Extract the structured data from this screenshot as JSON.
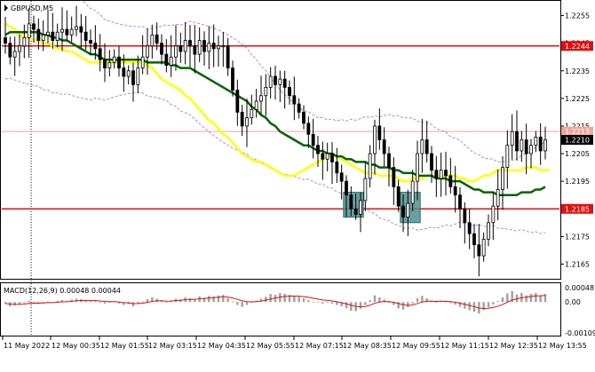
{
  "chart_data": {
    "type": "candlestick",
    "title": "GBPUSD,M5",
    "price_axis": {
      "range": [
        1.216,
        1.226
      ],
      "ticks": [
        "1.2255",
        "1.2245",
        "1.2235",
        "1.2225",
        "1.2215",
        "1.2205",
        "1.2195",
        "1.2185",
        "1.2175",
        "1.2165"
      ]
    },
    "time_axis_labels": [
      "11 May 2022",
      "12 May 00:35",
      "12 May 01:55",
      "12 May 03:15",
      "12 May 04:35",
      "12 May 05:55",
      "12 May 07:15",
      "12 May 08:35",
      "12 May 09:55",
      "12 May 11:15",
      "12 May 12:35",
      "12 May 13:55"
    ],
    "horizontal_levels": [
      {
        "value": 1.2244,
        "label": "1.2244",
        "color": "#e01010"
      },
      {
        "value": 1.2213,
        "label": "1.2213",
        "color": "#f4a59a"
      },
      {
        "value": 1.2185,
        "label": "1.2185",
        "color": "#e01010"
      }
    ],
    "current_price": {
      "value": 1.221,
      "label": "1.2210"
    },
    "closes": [
      1.2245,
      1.224,
      1.2242,
      1.2244,
      1.2247,
      1.2252,
      1.225,
      1.2246,
      1.2248,
      1.2249,
      1.2246,
      1.2249,
      1.225,
      1.2248,
      1.225,
      1.2251,
      1.2249,
      1.2246,
      1.2245,
      1.2243,
      1.2239,
      1.2236,
      1.2238,
      1.224,
      1.2236,
      1.2233,
      1.2235,
      1.223,
      1.2236,
      1.224,
      1.2244,
      1.2248,
      1.2245,
      1.2241,
      1.2237,
      1.224,
      1.2244,
      1.2242,
      1.2246,
      1.2244,
      1.2241,
      1.2246,
      1.2242,
      1.2245,
      1.2243,
      1.2244,
      1.2244,
      1.2236,
      1.2228,
      1.222,
      1.2215,
      1.2218,
      1.2221,
      1.2224,
      1.2226,
      1.2229,
      1.2233,
      1.223,
      1.2232,
      1.2229,
      1.2226,
      1.2223,
      1.222,
      1.2216,
      1.2212,
      1.2208,
      1.2205,
      1.2203,
      1.2205,
      1.2202,
      1.2198,
      1.2195,
      1.219,
      1.2185,
      1.2183,
      1.2188,
      1.2196,
      1.2205,
      1.2215,
      1.221,
      1.2205,
      1.22,
      1.2193,
      1.2186,
      1.2182,
      1.2187,
      1.2195,
      1.2205,
      1.221,
      1.2205,
      1.2199,
      1.2196,
      1.2199,
      1.2197,
      1.2193,
      1.219,
      1.2185,
      1.218,
      1.2176,
      1.2172,
      1.2168,
      1.2174,
      1.218,
      1.2186,
      1.2192,
      1.22,
      1.2208,
      1.2213,
      1.2206,
      1.221,
      1.2205,
      1.2208,
      1.2211,
      1.2206,
      1.221
    ],
    "sma_yellow": [
      1.2252,
      1.2251,
      1.225,
      1.2248,
      1.2247,
      1.2247,
      1.2246,
      1.2246,
      1.2245,
      1.2245,
      1.2244,
      1.2243,
      1.2243,
      1.2242,
      1.2242,
      1.2241,
      1.224,
      1.2239,
      1.2238,
      1.2238,
      1.2238,
      1.2238,
      1.2238,
      1.2238,
      1.2238,
      1.2238,
      1.2238,
      1.2238,
      1.2238,
      1.2238,
      1.2237,
      1.2236,
      1.2234,
      1.2232,
      1.2231,
      1.223,
      1.2229,
      1.2228,
      1.2226,
      1.2225,
      1.2223,
      1.2221,
      1.2219,
      1.2217,
      1.2216,
      1.2214,
      1.2212,
      1.2211,
      1.2209,
      1.2207,
      1.2205,
      1.2204,
      1.2203,
      1.2202,
      1.2202,
      1.2201,
      1.22,
      1.2199,
      1.2198,
      1.2197,
      1.2197,
      1.2197,
      1.2198,
      1.2199,
      1.22,
      1.2201,
      1.2202,
      1.2203,
      1.2204,
      1.2204,
      1.2204,
      1.2203,
      1.2202,
      1.2201,
      1.22,
      1.2199,
      1.2198,
      1.2198,
      1.2198,
      1.2197,
      1.2197,
      1.2197,
      1.2197,
      1.2196,
      1.2195,
      1.2195,
      1.2196,
      1.2196,
      1.2196,
      1.2197,
      1.2197,
      1.2197,
      1.2197,
      1.2197,
      1.2197,
      1.2197,
      1.2196,
      1.2196,
      1.2195,
      1.2195,
      1.2196,
      1.2197,
      1.2197,
      1.2198,
      1.2199,
      1.2199,
      1.2199,
      1.2199,
      1.2199,
      1.2199,
      1.22,
      1.22,
      1.22,
      1.2199,
      1.2199,
      1.2199
    ],
    "sma_green": [
      1.2248,
      1.2249,
      1.2249,
      1.2249,
      1.2249,
      1.2249,
      1.2249,
      1.2249,
      1.2248,
      1.2248,
      1.2247,
      1.2247,
      1.2246,
      1.2246,
      1.2245,
      1.2244,
      1.2243,
      1.2242,
      1.2241,
      1.2241,
      1.224,
      1.2239,
      1.2239,
      1.2239,
      1.2239,
      1.2239,
      1.2239,
      1.2239,
      1.2239,
      1.2239,
      1.2238,
      1.2238,
      1.2238,
      1.2238,
      1.2238,
      1.2237,
      1.2237,
      1.2236,
      1.2236,
      1.2236,
      1.2235,
      1.2234,
      1.2233,
      1.2232,
      1.2231,
      1.223,
      1.2229,
      1.2228,
      1.2227,
      1.2226,
      1.2225,
      1.2224,
      1.2222,
      1.2221,
      1.2219,
      1.2218,
      1.2216,
      1.2215,
      1.2213,
      1.2212,
      1.2211,
      1.221,
      1.2209,
      1.2208,
      1.2208,
      1.2207,
      1.2206,
      1.2206,
      1.2205,
      1.2205,
      1.2204,
      1.2204,
      1.2203,
      1.2203,
      1.2202,
      1.2202,
      1.2202,
      1.2201,
      1.2201,
      1.22,
      1.22,
      1.22,
      1.2199,
      1.2199,
      1.2198,
      1.2198,
      1.2198,
      1.2197,
      1.2197,
      1.2197,
      1.2197,
      1.2196,
      1.2196,
      1.2196,
      1.2195,
      1.2195,
      1.2195,
      1.2194,
      1.2193,
      1.2192,
      1.2192,
      1.2191,
      1.2191,
      1.2191,
      1.219,
      1.219,
      1.219,
      1.219,
      1.219,
      1.2191,
      1.2191,
      1.2191,
      1.2192,
      1.2192,
      1.2193
    ],
    "highlight_zones": [
      {
        "from": 72,
        "to": 75,
        "low": 1.2182,
        "high": 1.2191
      },
      {
        "from": 84,
        "to": 87,
        "low": 1.218,
        "high": 1.2191
      }
    ],
    "macd": {
      "label": "MACD(12,26,9) 0.00048 0.00044",
      "params": [
        12,
        26,
        9
      ],
      "main": 0.00048,
      "signal": 0.00044,
      "axis_ticks": [
        "0.00048",
        "0.00",
        "-0.00109"
      ],
      "range": [
        -0.00109,
        0.0006
      ]
    },
    "colors": {
      "candles": "#000000",
      "sma_fast": "#ffff00",
      "sma_slow": "#006400",
      "bands": "#c080e0",
      "level": "#e01010",
      "zone": "#4f8f8f",
      "macd_hist": "#a0a0a0",
      "macd_signal": "#e01010"
    }
  }
}
